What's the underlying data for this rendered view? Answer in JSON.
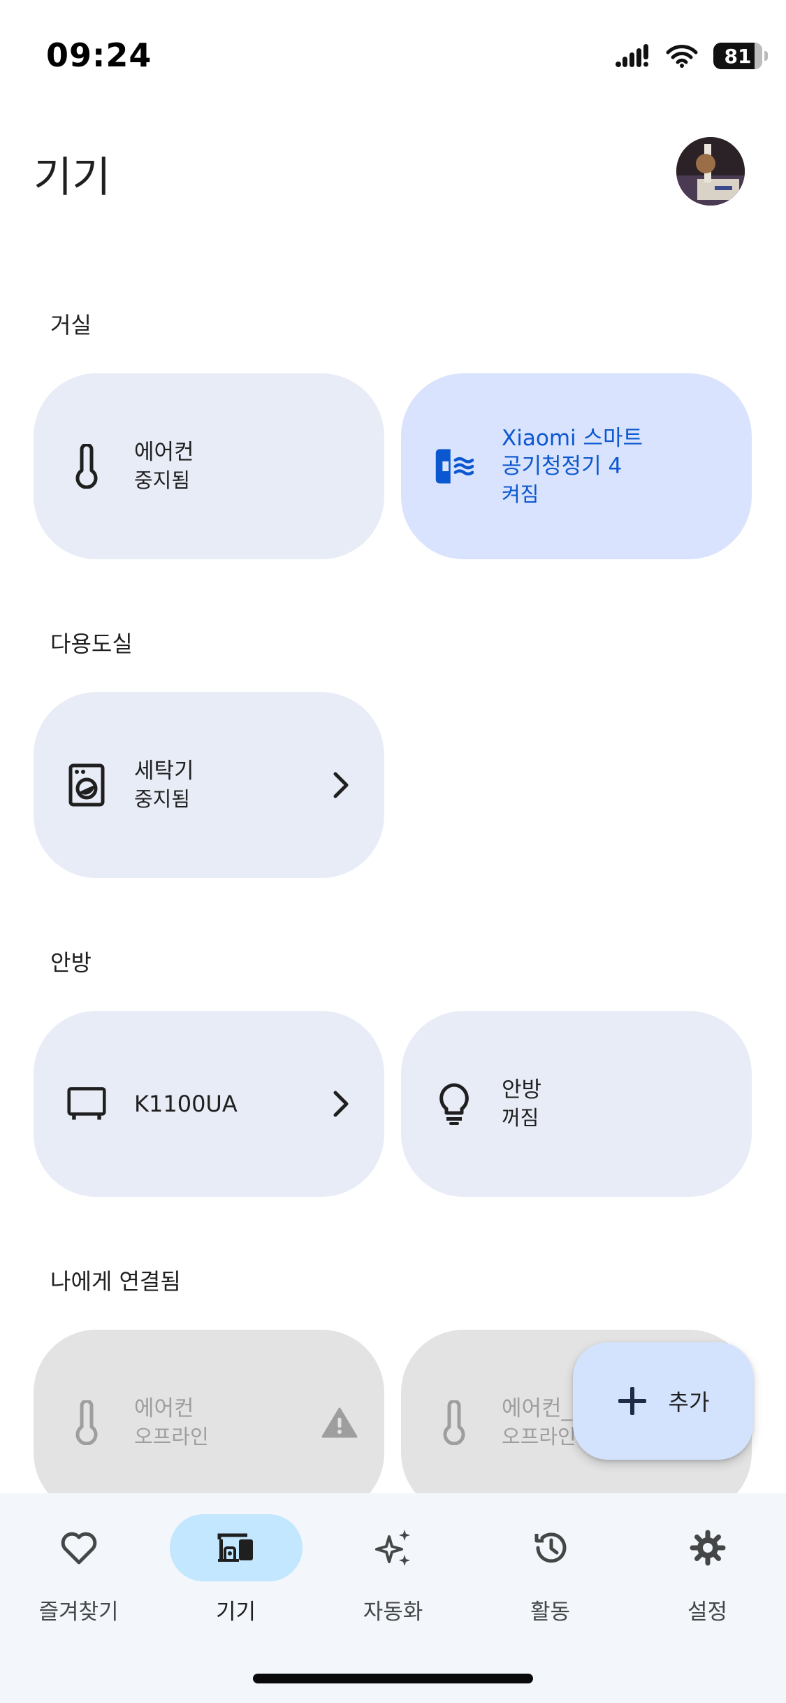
{
  "status_bar": {
    "time": "09:24",
    "battery": "81",
    "battery_level_percent": 81
  },
  "header": {
    "title": "기기"
  },
  "rooms": [
    {
      "label": "거실",
      "devices": [
        {
          "name": "에어컨",
          "status": "중지됨",
          "icon": "thermometer-icon"
        },
        {
          "name": "Xiaomi 스마트",
          "name_line2": "공기청정기 4",
          "status": "켜짐",
          "icon": "air-purifier-icon",
          "state": "active"
        }
      ]
    },
    {
      "label": "다용도실",
      "devices": [
        {
          "name": "세탁기",
          "status": "중지됨",
          "icon": "washer-icon",
          "has_chevron": true
        }
      ]
    },
    {
      "label": "안방",
      "devices": [
        {
          "name": "K1100UA",
          "icon": "tv-icon",
          "has_chevron": true
        },
        {
          "name": "안방",
          "status": "꺼짐",
          "icon": "lightbulb-icon"
        }
      ]
    },
    {
      "label": "나에게 연결됨",
      "devices": [
        {
          "name": "에어컨",
          "status": "오프라인",
          "icon": "thermometer-icon",
          "state": "offline",
          "warning": true
        },
        {
          "name": "에어컨_",
          "status": "오프라인",
          "icon": "thermometer-icon",
          "state": "offline"
        }
      ]
    }
  ],
  "fab": {
    "label": "추가",
    "icon": "plus-icon"
  },
  "bottom_nav": [
    {
      "label": "즐겨찾기",
      "icon": "heart-icon"
    },
    {
      "label": "기기",
      "icon": "devices-icon",
      "active": true
    },
    {
      "label": "자동화",
      "icon": "sparkle-icon"
    },
    {
      "label": "활동",
      "icon": "history-icon"
    },
    {
      "label": "설정",
      "icon": "gear-icon"
    }
  ],
  "colors": {
    "card": "#e8ecf6",
    "card_active": "#d9e3fd",
    "card_offline": "#e3e3e3",
    "accent_blue": "#0b57d0",
    "nav_active_pill": "#c2e7ff",
    "fab": "#d3e3fd"
  }
}
